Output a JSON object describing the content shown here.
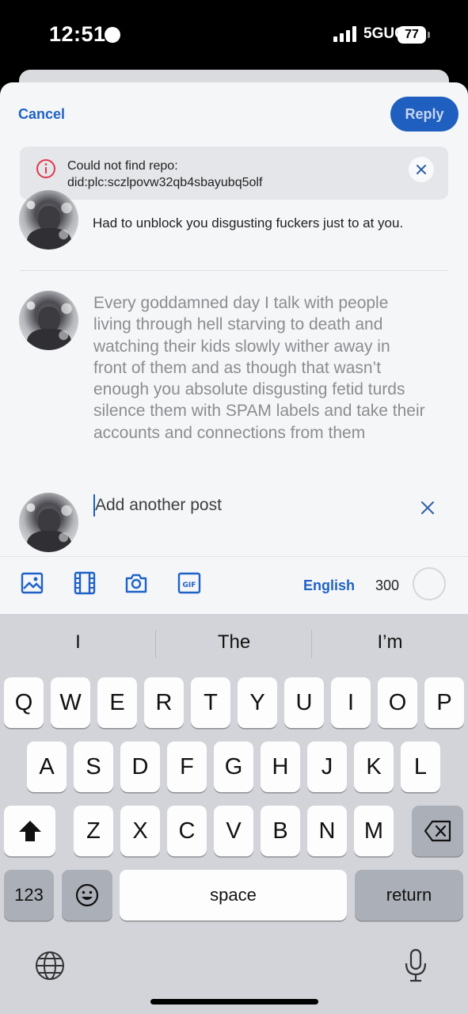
{
  "status_bar": {
    "time": "12:51",
    "network": "5GUC",
    "battery": "77"
  },
  "header": {
    "cancel_label": "Cancel",
    "reply_label": "Reply"
  },
  "error": {
    "line1": "Could not find repo:",
    "line2": "did:plc:sczlpovw32qb4sbayubq5olf"
  },
  "parent_post": {
    "text": "Had to unblock you disgusting fuckers just to at you."
  },
  "draft_post": {
    "text": "Every goddamned day I talk with people living through hell starving to death and watching their kids slowly wither away in front of them and as though that wasn’t enough you absolute disgusting fetid turds silence them with SPAM labels and take their accounts and connections from them"
  },
  "add_post": {
    "placeholder": "Add another post"
  },
  "toolbar": {
    "language": "English",
    "char_count": "300"
  },
  "keyboard": {
    "suggestions": [
      "I",
      "The",
      "I’m"
    ],
    "row1": [
      "Q",
      "W",
      "E",
      "R",
      "T",
      "Y",
      "U",
      "I",
      "O",
      "P"
    ],
    "row2": [
      "A",
      "S",
      "D",
      "F",
      "G",
      "H",
      "J",
      "K",
      "L"
    ],
    "row3": [
      "Z",
      "X",
      "C",
      "V",
      "B",
      "N",
      "M"
    ],
    "numbers_label": "123",
    "space_label": "space",
    "return_label": "return"
  },
  "colors": {
    "accent": "#1e62c8",
    "error": "#e0384d"
  }
}
